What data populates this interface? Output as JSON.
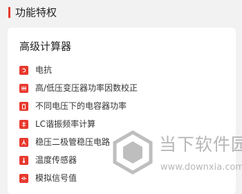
{
  "section": {
    "title": "功能特权"
  },
  "card": {
    "title": "高级计算器",
    "items": [
      {
        "label": "电抗",
        "icon": "reactance-icon"
      },
      {
        "label": "高/低压变压器功率因数校正",
        "icon": "transformer-icon"
      },
      {
        "label": "不同电压下的电容器功率",
        "icon": "battery-icon"
      },
      {
        "label": "LC谐振频率计算",
        "icon": "resonance-icon"
      },
      {
        "label": "稳压二极管稳压电路",
        "icon": "zener-diode-icon"
      },
      {
        "label": "温度传感器",
        "icon": "thermometer-icon"
      },
      {
        "label": "模拟信号值",
        "icon": "signal-icon"
      }
    ]
  },
  "watermark": {
    "name": "当下软件园",
    "url": "www.downxia.com"
  },
  "colors": {
    "accent": "#e8392e",
    "background": "#f2f2f2",
    "card": "#ffffff",
    "text": "#222222",
    "watermark": "#7d7d7d"
  }
}
